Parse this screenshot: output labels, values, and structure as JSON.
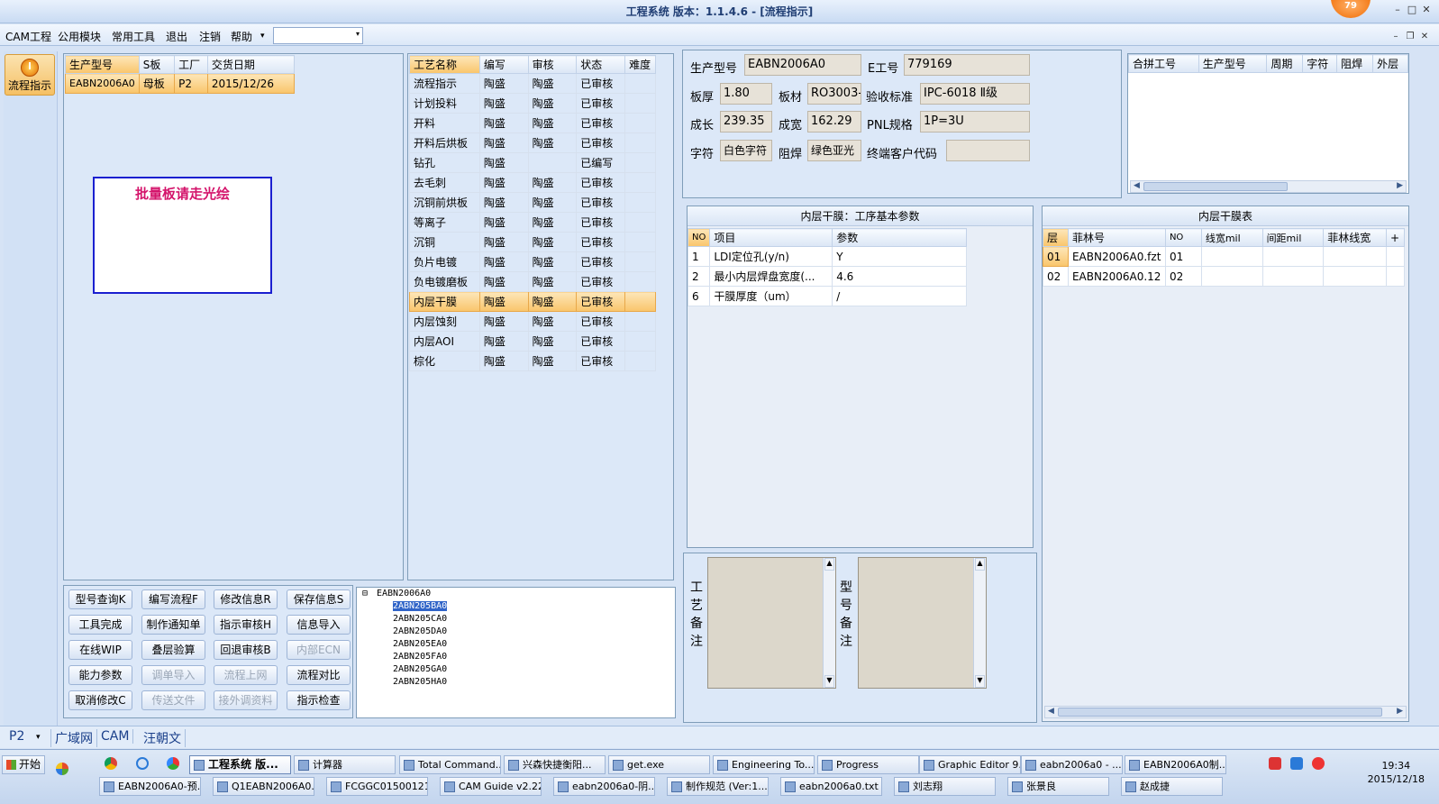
{
  "window": {
    "title": "工程系统   版本：1.1.4.6 - [流程指示]",
    "badge": "79",
    "controls": [
      "–",
      "□",
      "✕"
    ]
  },
  "menu": {
    "items": [
      "CAM工程",
      "公用模块",
      "常用工具",
      "退出",
      "注销",
      "帮助"
    ],
    "help_arrow": "▾",
    "combo_value": "",
    "combo_arrow": "▾",
    "mdi_controls": [
      "–",
      "❐",
      "✕"
    ]
  },
  "leftnav": {
    "button_label": "流程指示"
  },
  "model_table": {
    "headers": [
      "生产型号",
      "S板",
      "工厂",
      "交货日期"
    ],
    "rows": [
      [
        "EABN2006A0",
        "母板",
        "P2",
        "2015/12/26"
      ]
    ]
  },
  "notice": "批量板请走光绘",
  "process_table": {
    "headers": [
      "工艺名称",
      "编写",
      "审核",
      "状态",
      "难度"
    ],
    "rows": [
      [
        "流程指示",
        "陶盛",
        "陶盛",
        "已审核",
        ""
      ],
      [
        "计划投料",
        "陶盛",
        "陶盛",
        "已审核",
        ""
      ],
      [
        "开料",
        "陶盛",
        "陶盛",
        "已审核",
        ""
      ],
      [
        "开料后烘板",
        "陶盛",
        "陶盛",
        "已审核",
        ""
      ],
      [
        "钻孔",
        "陶盛",
        "",
        "已编写",
        ""
      ],
      [
        "去毛刺",
        "陶盛",
        "陶盛",
        "已审核",
        ""
      ],
      [
        "沉铜前烘板",
        "陶盛",
        "陶盛",
        "已审核",
        ""
      ],
      [
        "等离子",
        "陶盛",
        "陶盛",
        "已审核",
        ""
      ],
      [
        "沉铜",
        "陶盛",
        "陶盛",
        "已审核",
        ""
      ],
      [
        "负片电镀",
        "陶盛",
        "陶盛",
        "已审核",
        ""
      ],
      [
        "负电镀磨板",
        "陶盛",
        "陶盛",
        "已审核",
        ""
      ],
      [
        "内层干膜",
        "陶盛",
        "陶盛",
        "已审核",
        ""
      ],
      [
        "内层蚀刻",
        "陶盛",
        "陶盛",
        "已审核",
        ""
      ],
      [
        "内层AOI",
        "陶盛",
        "陶盛",
        "已审核",
        ""
      ],
      [
        "棕化",
        "陶盛",
        "陶盛",
        "已审核",
        ""
      ]
    ],
    "selected_index": 11
  },
  "buttons": [
    [
      "型号查询K",
      "编写流程F",
      "修改信息R",
      "保存信息S"
    ],
    [
      "工具完成",
      "制作通知单",
      "指示审核H",
      "信息导入"
    ],
    [
      "在线WIP",
      "叠层验算",
      "回退审核B",
      "内部ECN"
    ],
    [
      "能力参数",
      "调单导入",
      "流程上网",
      "流程对比"
    ],
    [
      "取消修改C",
      "传送文件",
      "接外调资料",
      "指示检查"
    ]
  ],
  "tree": {
    "root": "EABN2006A0",
    "toggle": "⊟",
    "children": [
      "2ABN205BA0",
      "2ABN205CA0",
      "2ABN205DA0",
      "2ABN205EA0",
      "2ABN205FA0",
      "2ABN205GA0",
      "2ABN205HA0"
    ],
    "selected_index": 0
  },
  "info": {
    "prod_model_label": "生产型号",
    "prod_model": "EABN2006A0",
    "e_no_label": "E工号",
    "e_no": "779169",
    "thickness_label": "板厚",
    "thickness": "1.80",
    "material_label": "板材",
    "material": "RO3003-",
    "accept_label": "验收标准",
    "accept": "IPC-6018 Ⅱ级",
    "length_label": "成长",
    "length": "239.35",
    "width_label": "成宽",
    "width": "162.29",
    "pnl_label": "PNL规格",
    "pnl": "1P=3U",
    "legend_label": "字符",
    "legend": "白色字符",
    "mask_label": "阻焊",
    "mask": "绿色亚光",
    "customer_label": "终端客户代码",
    "customer": ""
  },
  "combine_table": {
    "headers": [
      "合拼工号",
      "生产型号",
      "周期",
      "字符",
      "阻焊",
      "外层"
    ]
  },
  "param_panel": {
    "caption": "内层干膜：工序基本参数",
    "headers": [
      "NO",
      "项目",
      "参数"
    ],
    "rows": [
      [
        "1",
        "LDI定位孔(y/n)",
        "Y"
      ],
      [
        "2",
        "最小内层焊盘宽度(...",
        "4.6"
      ],
      [
        "6",
        "干膜厚度（um）",
        "/"
      ]
    ]
  },
  "film_panel": {
    "caption": "内层干膜表",
    "headers": [
      "层",
      "菲林号",
      "NO",
      "线宽mil",
      "间距mil",
      "菲林线宽",
      "+"
    ],
    "rows": [
      [
        "01",
        "EABN2006A0.fzt",
        "01",
        "",
        "",
        "",
        ""
      ],
      [
        "02",
        "EABN2006A0.12",
        "02",
        "",
        "",
        "",
        ""
      ]
    ]
  },
  "remarks": {
    "process_label": "工艺备注",
    "model_label": "型号备注"
  },
  "statusbar": {
    "tabs": [
      "P2",
      "广域网",
      "CAM",
      "汪朝文"
    ],
    "arrow": "▾"
  },
  "taskbar": {
    "start": "开始",
    "row1": [
      "工程系统  版...",
      "计算器",
      "Total Command...",
      "兴森快捷衡阳...",
      "get.exe",
      "Engineering To...",
      "Progress",
      "Graphic Editor 9...",
      "eabn2006a0 - ...",
      "EABN2006A0制..."
    ],
    "row2": [
      "EABN2006A0-预...",
      "Q1EABN2006A0...",
      "FCGGC01500121...",
      "CAM Guide v2.22",
      "eabn2006a0-阴...",
      "制作规范 (Ver:1...",
      "eabn2006a0.txt -...",
      "刘志翔",
      "张景良",
      "赵成捷"
    ],
    "time": "19:34",
    "date": "2015/12/18"
  }
}
